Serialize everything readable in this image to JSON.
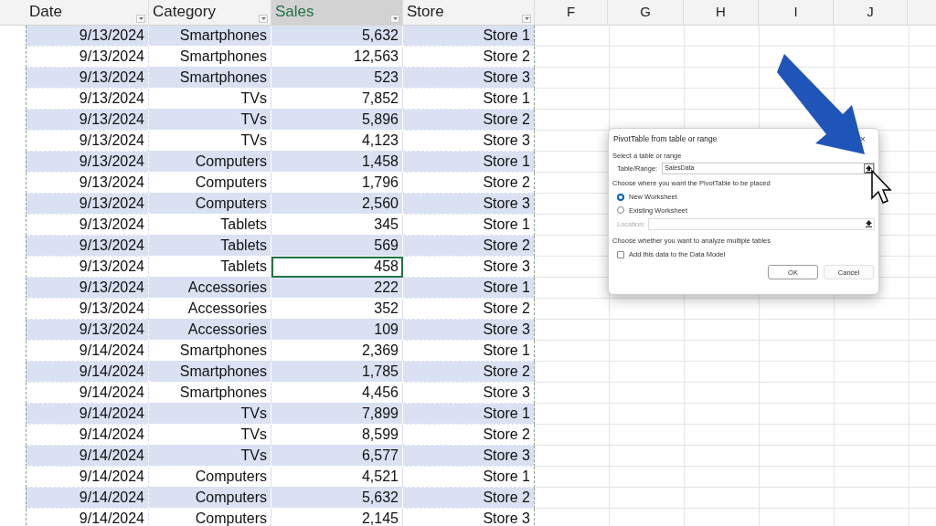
{
  "columns": [
    {
      "label": "Date",
      "filter": true,
      "selected": false
    },
    {
      "label": "Category",
      "filter": true,
      "selected": false
    },
    {
      "label": "Sales",
      "filter": true,
      "selected": true
    },
    {
      "label": "Store",
      "filter": true,
      "selected": false
    },
    {
      "label": "F",
      "filter": false,
      "selected": false
    },
    {
      "label": "G",
      "filter": false,
      "selected": false
    },
    {
      "label": "H",
      "filter": false,
      "selected": false
    },
    {
      "label": "I",
      "filter": false,
      "selected": false
    },
    {
      "label": "J",
      "filter": false,
      "selected": false
    }
  ],
  "rows": [
    {
      "cells": [
        "9/13/2024",
        "Smartphones",
        "5,632",
        "Store 1"
      ],
      "banded": true,
      "selected": false
    },
    {
      "cells": [
        "9/13/2024",
        "Smartphones",
        "12,563",
        "Store 2"
      ],
      "banded": false,
      "selected": false
    },
    {
      "cells": [
        "9/13/2024",
        "Smartphones",
        "523",
        "Store 3"
      ],
      "banded": true,
      "selected": false
    },
    {
      "cells": [
        "9/13/2024",
        "TVs",
        "7,852",
        "Store 1"
      ],
      "banded": false,
      "selected": false
    },
    {
      "cells": [
        "9/13/2024",
        "TVs",
        "5,896",
        "Store 2"
      ],
      "banded": true,
      "selected": false
    },
    {
      "cells": [
        "9/13/2024",
        "TVs",
        "4,123",
        "Store 3"
      ],
      "banded": false,
      "selected": false
    },
    {
      "cells": [
        "9/13/2024",
        "Computers",
        "1,458",
        "Store 1"
      ],
      "banded": true,
      "selected": false
    },
    {
      "cells": [
        "9/13/2024",
        "Computers",
        "1,796",
        "Store 2"
      ],
      "banded": false,
      "selected": false
    },
    {
      "cells": [
        "9/13/2024",
        "Computers",
        "2,560",
        "Store 3"
      ],
      "banded": true,
      "selected": false
    },
    {
      "cells": [
        "9/13/2024",
        "Tablets",
        "345",
        "Store 1"
      ],
      "banded": false,
      "selected": false
    },
    {
      "cells": [
        "9/13/2024",
        "Tablets",
        "569",
        "Store 2"
      ],
      "banded": true,
      "selected": false
    },
    {
      "cells": [
        "9/13/2024",
        "Tablets",
        "458",
        "Store 3"
      ],
      "banded": false,
      "selected": true
    },
    {
      "cells": [
        "9/13/2024",
        "Accessories",
        "222",
        "Store 1"
      ],
      "banded": true,
      "selected": false
    },
    {
      "cells": [
        "9/13/2024",
        "Accessories",
        "352",
        "Store 2"
      ],
      "banded": false,
      "selected": false
    },
    {
      "cells": [
        "9/13/2024",
        "Accessories",
        "109",
        "Store 3"
      ],
      "banded": true,
      "selected": false
    },
    {
      "cells": [
        "9/14/2024",
        "Smartphones",
        "2,369",
        "Store 1"
      ],
      "banded": false,
      "selected": false
    },
    {
      "cells": [
        "9/14/2024",
        "Smartphones",
        "1,785",
        "Store 2"
      ],
      "banded": true,
      "selected": false
    },
    {
      "cells": [
        "9/14/2024",
        "Smartphones",
        "4,456",
        "Store 3"
      ],
      "banded": false,
      "selected": false
    },
    {
      "cells": [
        "9/14/2024",
        "TVs",
        "7,899",
        "Store 1"
      ],
      "banded": true,
      "selected": false
    },
    {
      "cells": [
        "9/14/2024",
        "TVs",
        "8,599",
        "Store 2"
      ],
      "banded": false,
      "selected": false
    },
    {
      "cells": [
        "9/14/2024",
        "TVs",
        "6,577",
        "Store 3"
      ],
      "banded": true,
      "selected": false
    },
    {
      "cells": [
        "9/14/2024",
        "Computers",
        "4,521",
        "Store 1"
      ],
      "banded": false,
      "selected": false
    },
    {
      "cells": [
        "9/14/2024",
        "Computers",
        "5,632",
        "Store 2"
      ],
      "banded": true,
      "selected": false
    },
    {
      "cells": [
        "9/14/2024",
        "Computers",
        "2,145",
        "Store 3"
      ],
      "banded": false,
      "selected": false
    }
  ],
  "dialog": {
    "title": "PivotTable from table or range",
    "close": "×",
    "section_1": "Select a table or range",
    "range_label": "Table/Range:",
    "range_value": "SalesData",
    "section_2": "Choose where you want the PivotTable to be placed",
    "options": [
      {
        "label": "New Worksheet",
        "selected": true
      },
      {
        "label": "Existing Worksheet",
        "selected": false
      }
    ],
    "location_label": "Location:",
    "location_disabled": true,
    "section_3": "Choose whether you want to analyze multiple tables",
    "data_model": {
      "label": "Add this data to the Data Model",
      "checked": false
    },
    "buttons": [
      {
        "label": "OK",
        "default": true
      },
      {
        "label": "Cancel",
        "default": false
      }
    ]
  }
}
